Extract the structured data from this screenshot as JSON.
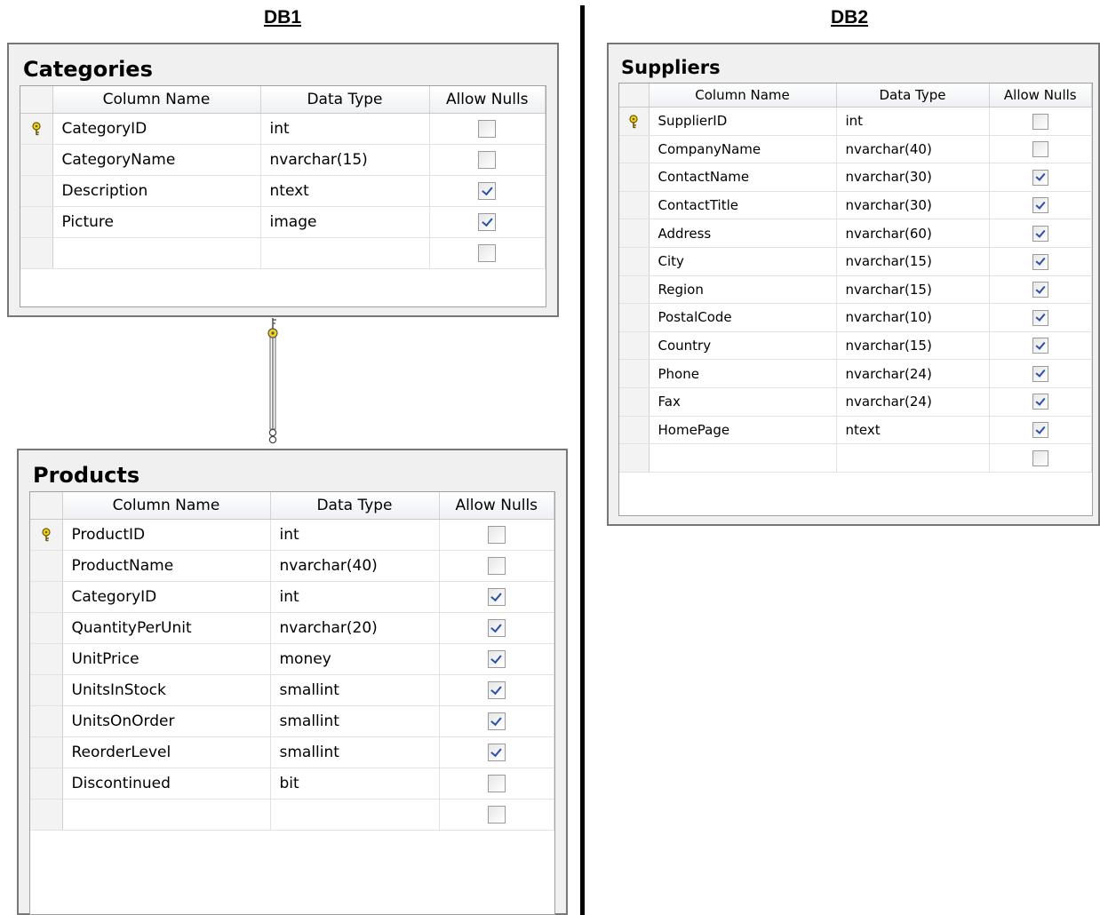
{
  "labels": {
    "db1": "DB1",
    "db2": "DB2"
  },
  "headers": {
    "column_name": "Column Name",
    "data_type": "Data Type",
    "allow_nulls": "Allow Nulls"
  },
  "categories": {
    "title": "Categories",
    "rows": [
      {
        "key": true,
        "name": "CategoryID",
        "type": "int",
        "nulls": false
      },
      {
        "key": false,
        "name": "CategoryName",
        "type": "nvarchar(15)",
        "nulls": false
      },
      {
        "key": false,
        "name": "Description",
        "type": "ntext",
        "nulls": true
      },
      {
        "key": false,
        "name": "Picture",
        "type": "image",
        "nulls": true
      },
      {
        "key": false,
        "name": "",
        "type": "",
        "nulls": false
      }
    ]
  },
  "products": {
    "title": "Products",
    "rows": [
      {
        "key": true,
        "name": "ProductID",
        "type": "int",
        "nulls": false
      },
      {
        "key": false,
        "name": "ProductName",
        "type": "nvarchar(40)",
        "nulls": false
      },
      {
        "key": false,
        "name": "CategoryID",
        "type": "int",
        "nulls": true
      },
      {
        "key": false,
        "name": "QuantityPerUnit",
        "type": "nvarchar(20)",
        "nulls": true
      },
      {
        "key": false,
        "name": "UnitPrice",
        "type": "money",
        "nulls": true
      },
      {
        "key": false,
        "name": "UnitsInStock",
        "type": "smallint",
        "nulls": true
      },
      {
        "key": false,
        "name": "UnitsOnOrder",
        "type": "smallint",
        "nulls": true
      },
      {
        "key": false,
        "name": "ReorderLevel",
        "type": "smallint",
        "nulls": true
      },
      {
        "key": false,
        "name": "Discontinued",
        "type": "bit",
        "nulls": false
      },
      {
        "key": false,
        "name": "",
        "type": "",
        "nulls": false
      }
    ]
  },
  "suppliers": {
    "title": "Suppliers",
    "rows": [
      {
        "key": true,
        "name": "SupplierID",
        "type": "int",
        "nulls": false
      },
      {
        "key": false,
        "name": "CompanyName",
        "type": "nvarchar(40)",
        "nulls": false
      },
      {
        "key": false,
        "name": "ContactName",
        "type": "nvarchar(30)",
        "nulls": true
      },
      {
        "key": false,
        "name": "ContactTitle",
        "type": "nvarchar(30)",
        "nulls": true
      },
      {
        "key": false,
        "name": "Address",
        "type": "nvarchar(60)",
        "nulls": true
      },
      {
        "key": false,
        "name": "City",
        "type": "nvarchar(15)",
        "nulls": true
      },
      {
        "key": false,
        "name": "Region",
        "type": "nvarchar(15)",
        "nulls": true
      },
      {
        "key": false,
        "name": "PostalCode",
        "type": "nvarchar(10)",
        "nulls": true
      },
      {
        "key": false,
        "name": "Country",
        "type": "nvarchar(15)",
        "nulls": true
      },
      {
        "key": false,
        "name": "Phone",
        "type": "nvarchar(24)",
        "nulls": true
      },
      {
        "key": false,
        "name": "Fax",
        "type": "nvarchar(24)",
        "nulls": true
      },
      {
        "key": false,
        "name": "HomePage",
        "type": "ntext",
        "nulls": true
      },
      {
        "key": false,
        "name": "",
        "type": "",
        "nulls": false
      }
    ]
  },
  "colors": {
    "key_yellow": "#f2d31c",
    "check_blue": "#2b4fa8",
    "window_border": "#777777"
  }
}
